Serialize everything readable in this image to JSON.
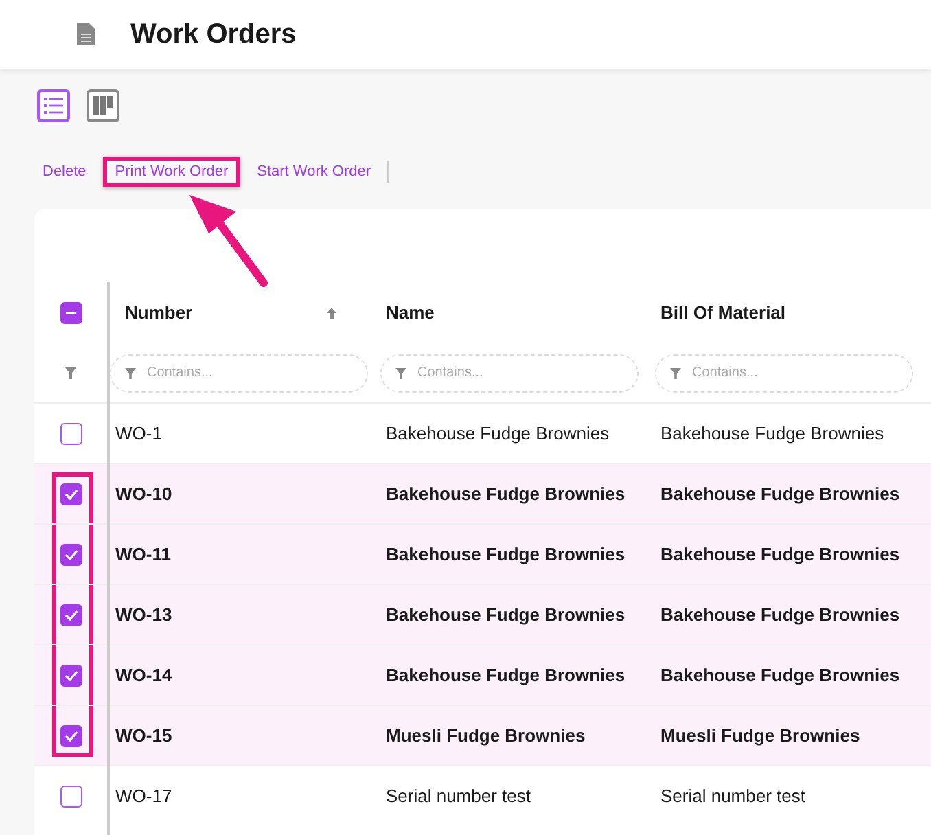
{
  "header": {
    "title": "Work Orders"
  },
  "views": [
    {
      "kind": "list",
      "selected": true
    },
    {
      "kind": "board",
      "selected": false
    }
  ],
  "actions": [
    {
      "label": "Delete",
      "highlighted": false
    },
    {
      "label": "Print Work Order",
      "highlighted": true
    },
    {
      "label": "Start Work Order",
      "highlighted": false
    }
  ],
  "table": {
    "select_all": {
      "indeterminate": true
    },
    "columns": [
      {
        "label": "Number",
        "sorted": true,
        "filter_placeholder": "Contains..."
      },
      {
        "label": "Name",
        "sorted": false,
        "filter_placeholder": "Contains..."
      },
      {
        "label": "Bill Of Material",
        "sorted": false,
        "filter_placeholder": "Contains..."
      }
    ],
    "rows": [
      {
        "selected": false,
        "highlighted": false,
        "cells": [
          "WO-1",
          "Bakehouse Fudge Brownies",
          "Bakehouse Fudge Brownies"
        ]
      },
      {
        "selected": true,
        "highlighted": true,
        "cells": [
          "WO-10",
          "Bakehouse Fudge Brownies",
          "Bakehouse Fudge Brownies"
        ]
      },
      {
        "selected": true,
        "highlighted": true,
        "cells": [
          "WO-11",
          "Bakehouse Fudge Brownies",
          "Bakehouse Fudge Brownies"
        ]
      },
      {
        "selected": true,
        "highlighted": true,
        "cells": [
          "WO-13",
          "Bakehouse Fudge Brownies",
          "Bakehouse Fudge Brownies"
        ]
      },
      {
        "selected": true,
        "highlighted": true,
        "cells": [
          "WO-14",
          "Bakehouse Fudge Brownies",
          "Bakehouse Fudge Brownies"
        ]
      },
      {
        "selected": true,
        "highlighted": true,
        "cells": [
          "WO-15",
          "Muesli Fudge Brownies",
          "Muesli Fudge Brownies"
        ]
      },
      {
        "selected": false,
        "highlighted": false,
        "cells": [
          "WO-17",
          "Serial number test",
          "Serial number test"
        ]
      }
    ]
  }
}
